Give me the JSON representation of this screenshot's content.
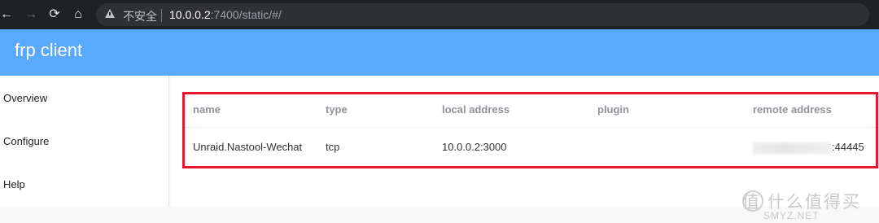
{
  "browser": {
    "back_icon": "←",
    "forward_icon": "→",
    "reload_icon": "⟳",
    "home_icon": "⌂",
    "insecure_label": "不安全",
    "url_host": "10.0.0.2",
    "url_rest": ":7400/static/#/"
  },
  "app": {
    "title": "frp client"
  },
  "sidebar": {
    "items": [
      {
        "label": "Overview"
      },
      {
        "label": "Configure"
      },
      {
        "label": "Help"
      }
    ]
  },
  "table": {
    "headers": [
      "name",
      "type",
      "local address",
      "plugin",
      "remote address"
    ],
    "rows": [
      {
        "name": "Unraid.Nastool-Wechat",
        "type": "tcp",
        "local_address": "10.0.0.2:3000",
        "plugin": "",
        "remote_port": ":44445"
      }
    ]
  },
  "watermark": {
    "text": "值 什么值得买",
    "sub": "SMYZ.NET"
  },
  "colors": {
    "header": "#58a9ff",
    "highlight": "#e8182b"
  }
}
